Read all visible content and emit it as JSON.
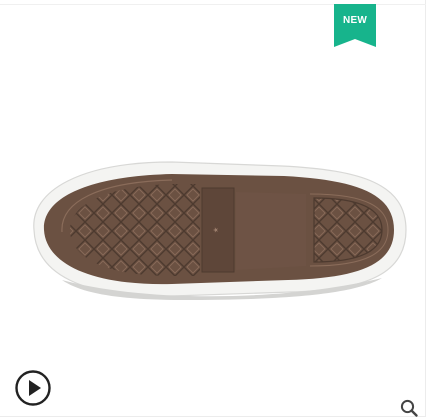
{
  "badge": {
    "label": "NEW",
    "color": "#17b48c"
  },
  "product_image": {
    "icon": "shoe-sole-image",
    "sole_color": "#6b5142",
    "rim_color": "#f4f4f2"
  },
  "controls": {
    "play": {
      "icon": "play-circle-icon"
    },
    "zoom": {
      "icon": "magnifier-icon"
    }
  }
}
